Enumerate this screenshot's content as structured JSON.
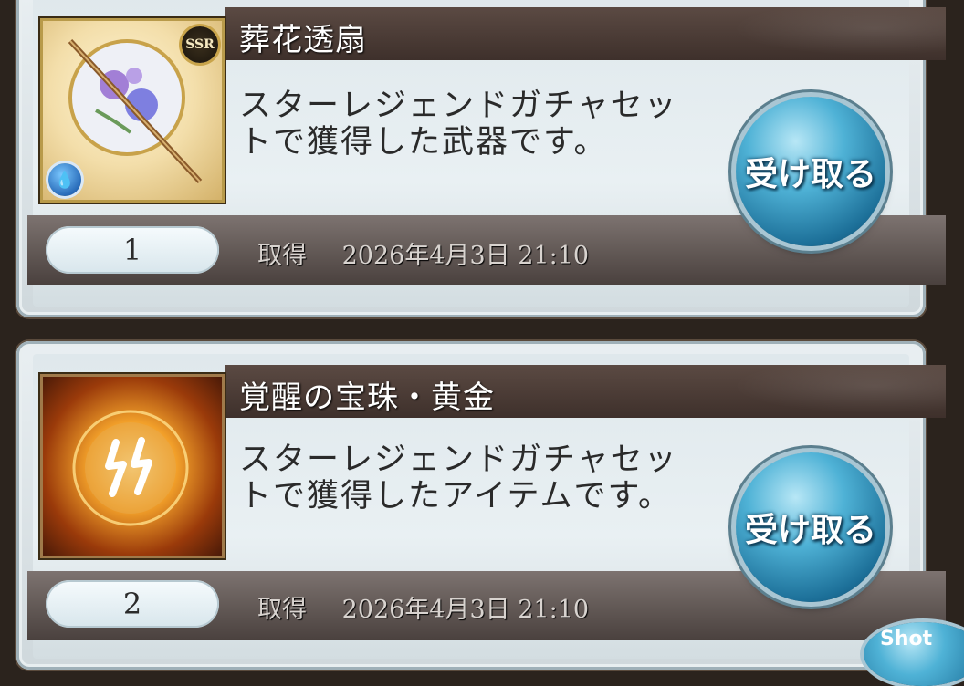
{
  "items": [
    {
      "name": "葬花透扇",
      "description": "スターレジェンドガチャセットで獲得した武器です。",
      "rarity": "SSR",
      "quantity": "1",
      "obtained_label": "取得",
      "obtained_date": "2026年4月3日 21:10",
      "receive_label": "受け取る",
      "icon": "fan-weapon-icon",
      "element_icon": "water-element-icon"
    },
    {
      "name": "覚醒の宝珠・黄金",
      "description": "スターレジェンドガチャセットで獲得したアイテムです。",
      "quantity": "2",
      "obtained_label": "取得",
      "obtained_date": "2026年4月3日 21:10",
      "receive_label": "受け取る",
      "icon": "golden-orb-icon"
    }
  ],
  "partial_button": "Shot"
}
